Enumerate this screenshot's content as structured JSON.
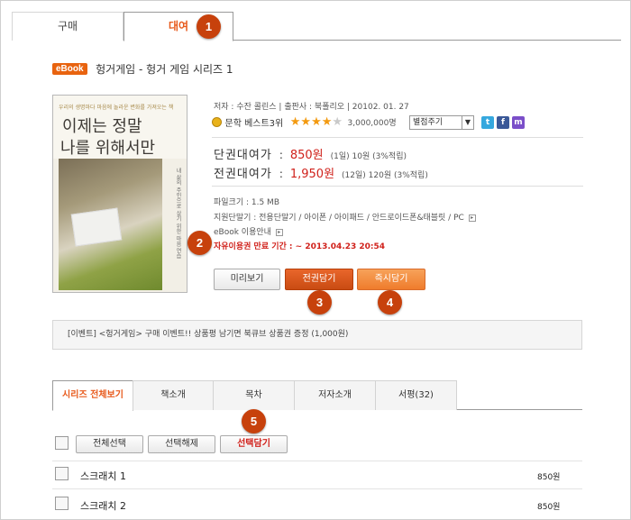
{
  "top_tabs": {
    "buy": "구매",
    "rent": "대여"
  },
  "badges": {
    "b1": "1",
    "b2": "2",
    "b3": "3",
    "b4": "4",
    "b5": "5"
  },
  "book": {
    "tag": "eBook",
    "title": "헝거게임 - 헝거 게임 시리즈 1",
    "cover_line": "우리의 생명마다 마음에 놀라운 변화를 가져오는 책",
    "cover_title_1": "이제는 정말",
    "cover_title_2": "나를 위해서만",
    "cover_side": "내 삶의 주인으로 살기 위한 마음 연습"
  },
  "meta": "저자 : 수잔 콜린스 | 출판사 : 북폴리오 | 20102. 01. 27",
  "rank": {
    "label": "문학 베스트3위",
    "rating": 4,
    "rating_max": 5,
    "count": "3,000,000명",
    "rating_select": "별점주기"
  },
  "share_icons": [
    "twitter-icon",
    "facebook-icon",
    "me2day-icon"
  ],
  "prices": {
    "single_label": "단권대여가",
    "single_price": "850원",
    "single_detail": "(1일)   10원 (3%적립)",
    "full_label": "전권대여가",
    "full_price": "1,950원",
    "full_detail": "(12일)   120원 (3%적립)"
  },
  "specs": {
    "filesize": "파일크기 : 1.5 MB",
    "devices": "지원단말기 : 전용단말기 / 아이폰 / 아이패드 / 안드로이드폰&태블릿 / PC",
    "guide": "eBook 이용안내"
  },
  "period": "자유이용권 만료 기간 : ~ 2013.04.23 20:54",
  "buttons": {
    "preview": "미리보기",
    "cart": "전권담기",
    "borrow": "즉시담기"
  },
  "event": "[이벤트] <헝거게임> 구매 이벤트!!  상품평 남기면 북큐브 상품권 증정 (1,000원)",
  "bottom_tabs": [
    "시리즈 전체보기",
    "책소개",
    "목차",
    "저자소개",
    "서평(32)"
  ],
  "toolbar": {
    "select_all": "전체선택",
    "deselect": "선택해제",
    "add_selected": "선택담기"
  },
  "items": [
    {
      "name": "스크래치 1",
      "price": "850원"
    },
    {
      "name": "스크래치 2",
      "price": "850원"
    }
  ],
  "colors": {
    "accent": "#e85a1c",
    "badge": "#c7410c",
    "price_red": "#d0211b"
  }
}
